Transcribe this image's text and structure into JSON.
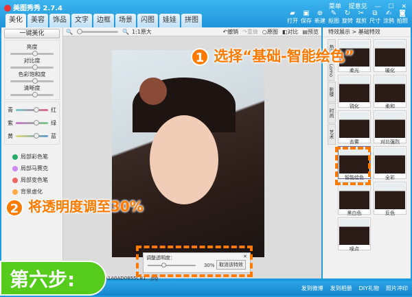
{
  "app": {
    "title": "美图秀秀 2.7.4",
    "menu": "菜单",
    "feedback": "提意见",
    "min": "—",
    "max": "☐",
    "close": "✕"
  },
  "tabs": [
    "美化",
    "美容",
    "饰品",
    "文字",
    "边框",
    "场景",
    "闪图",
    "娃娃",
    "拼图"
  ],
  "toolbar": [
    "打开",
    "保存",
    "新建",
    "抠图",
    "旋转",
    "裁剪",
    "尺寸",
    "涂鸦",
    "拍照"
  ],
  "left": {
    "auto_button": "一键美化",
    "sliders": [
      "亮度",
      "对比度",
      "色彩饱和度",
      "清晰度"
    ],
    "color_rows": [
      {
        "l": "青",
        "r": "红"
      },
      {
        "l": "紫",
        "r": "绿"
      },
      {
        "l": "黄",
        "r": "蓝"
      }
    ],
    "tools": [
      "局部彩色笔",
      "局部马赛克",
      "局部变色笔",
      "背景虚化"
    ]
  },
  "canvas": {
    "zoom_label": "1:1原大",
    "undo": "撤销",
    "redo": "重做",
    "original": "原图",
    "compare": "对比",
    "preview": "预览",
    "hash": "A1A0AD0855CB1...jpg"
  },
  "opacity_popup": {
    "title": "调整透明度：",
    "value": "30%",
    "cancel": "取消该特效",
    "close": "✕"
  },
  "right": {
    "breadcrumb": "特效展示 > 基础特效",
    "vtabs": [
      "热门",
      "Lomo",
      "影楼",
      "时尚",
      "艺术"
    ],
    "effects": [
      "柔光",
      "暖化",
      "锐化",
      "柔和",
      "去雾",
      "对比强烈",
      "智能绘色",
      "全彩",
      "黑白色",
      "反色",
      "噪点"
    ],
    "selected": "智能绘色"
  },
  "status": [
    "发到微博",
    "发到相册",
    "DIY礼物",
    "照片冲印"
  ],
  "annotations": {
    "n1": "1",
    "text1": "选择“基础-智能绘色”",
    "n2": "2",
    "text2": "将透明度调至30%",
    "step": "第六步:"
  },
  "colors": {
    "accent": "#ff7a00",
    "step_bg": "#55cc1c",
    "chrome": "#1e9be0"
  }
}
